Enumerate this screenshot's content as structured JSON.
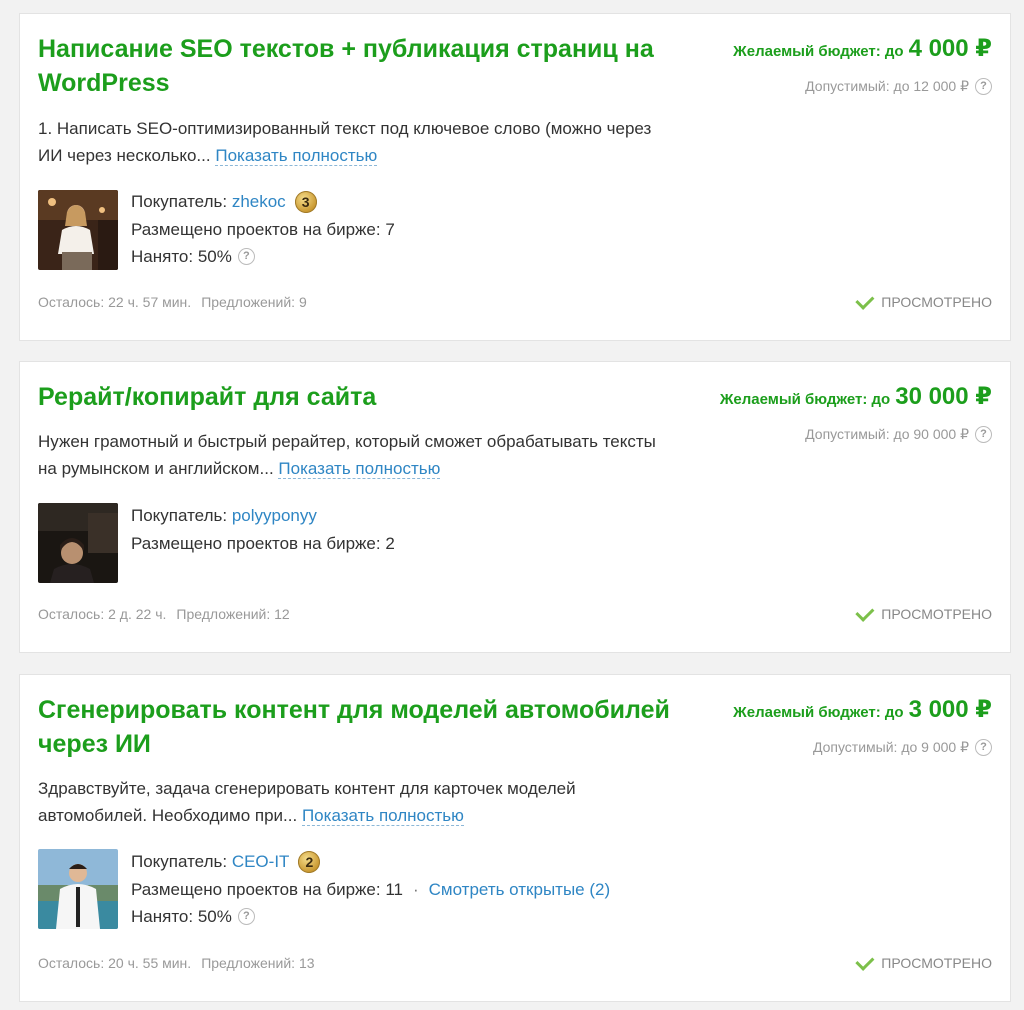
{
  "colors": {
    "accent_green": "#1c9e1c",
    "link_blue": "#2f86c4",
    "muted": "#999999"
  },
  "projects": [
    {
      "title": "Написание SEO текстов + публикация страниц на WordPress",
      "budget_label": "Желаемый бюджет: до",
      "budget_amount": "4 000 ₽",
      "allowed": "Допустимый: до 12 000 ₽",
      "description": "1. Написать SEO-оптимизированный текст под ключевое слово (можно через ИИ через несколько...",
      "show_more": "Показать полностью",
      "buyer_label": "Покупатель:",
      "buyer_name": "zhekoc",
      "buyer_level": "3",
      "projects_posted": "Размещено проектов на бирже: 7",
      "hired": "Нанято: 50%",
      "time_left": "Осталось: 22 ч. 57 мин.",
      "offers": "Предложений: 9",
      "status": "ПРОСМОТРЕНО"
    },
    {
      "title": "Рерайт/копирайт для сайта",
      "budget_label": "Желаемый бюджет: до",
      "budget_amount": "30 000 ₽",
      "allowed": "Допустимый: до 90 000 ₽",
      "description": "Нужен грамотный и быстрый рерайтер, который сможет обрабатывать тексты на румынском и английском...",
      "show_more": "Показать полностью",
      "buyer_label": "Покупатель:",
      "buyer_name": "polyyponyy",
      "projects_posted": "Размещено проектов на бирже: 2",
      "time_left": "Осталось: 2 д. 22 ч.",
      "offers": "Предложений: 12",
      "status": "ПРОСМОТРЕНО"
    },
    {
      "title": "Сгенерировать контент для моделей автомобилей через ИИ",
      "budget_label": "Желаемый бюджет: до",
      "budget_amount": "3 000 ₽",
      "allowed": "Допустимый: до 9 000 ₽",
      "description": "Здравствуйте, задача сгенерировать контент для карточек моделей автомобилей. Необходимо при...",
      "show_more": "Показать полностью",
      "buyer_label": "Покупатель:",
      "buyer_name": "CEO-IT",
      "buyer_level": "2",
      "projects_posted": "Размещено проектов на бирже: 11",
      "open_link": "Смотреть открытые (2)",
      "hired": "Нанято: 50%",
      "time_left": "Осталось: 20 ч. 55 мин.",
      "offers": "Предложений: 13",
      "status": "ПРОСМОТРЕНО"
    }
  ]
}
